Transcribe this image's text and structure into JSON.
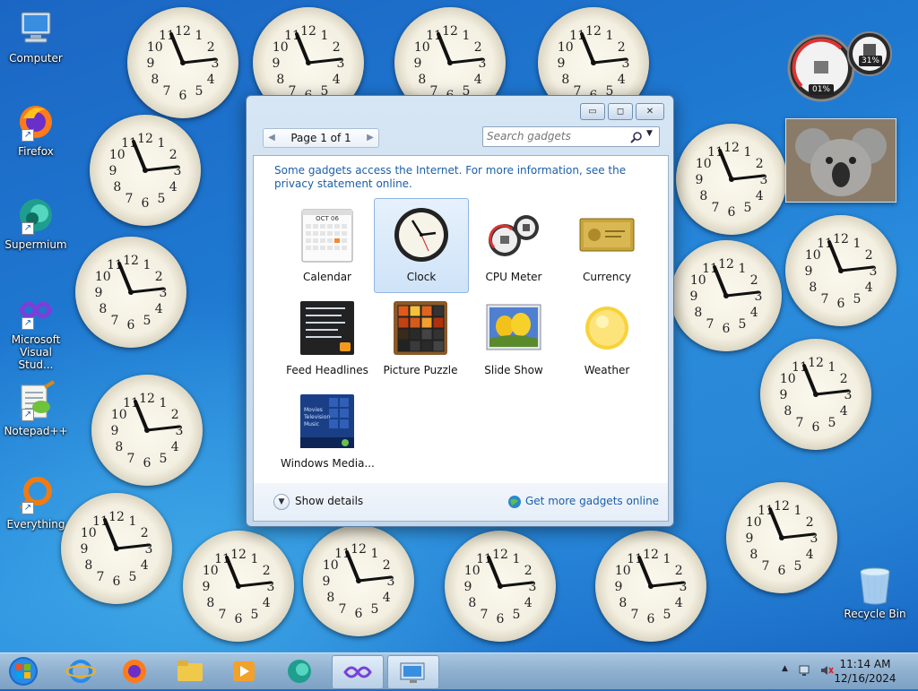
{
  "desktop": {
    "icons": [
      {
        "label": "Computer",
        "icon": "computer-icon"
      },
      {
        "label": "Firefox",
        "icon": "firefox-icon"
      },
      {
        "label": "Supermium",
        "icon": "supermium-icon"
      },
      {
        "label": "Microsoft Visual Stud...",
        "icon": "visual-studio-icon"
      },
      {
        "label": "Notepad++",
        "icon": "notepadpp-icon"
      },
      {
        "label": "Everything",
        "icon": "everything-icon"
      }
    ],
    "recycle_bin": "Recycle Bin"
  },
  "side_gadgets": {
    "cpu_meter": {
      "cpu_percent": "01%",
      "memory_percent": "31%"
    },
    "slideshow_image": "koala-photo"
  },
  "gadget_window": {
    "pager": {
      "text": "Page 1 of 1"
    },
    "search": {
      "placeholder": "Search gadgets"
    },
    "notice": "Some gadgets access the Internet.  For more information, see the privacy statement online.",
    "gadgets": [
      {
        "label": "Calendar",
        "icon": "calendar-icon",
        "month": "OCT 06"
      },
      {
        "label": "Clock",
        "icon": "clock-icon",
        "selected": true
      },
      {
        "label": "CPU Meter",
        "icon": "cpu-meter-icon"
      },
      {
        "label": "Currency",
        "icon": "currency-icon"
      },
      {
        "label": "Feed Headlines",
        "icon": "feed-headlines-icon"
      },
      {
        "label": "Picture Puzzle",
        "icon": "picture-puzzle-icon"
      },
      {
        "label": "Slide Show",
        "icon": "slide-show-icon"
      },
      {
        "label": "Weather",
        "icon": "weather-icon"
      },
      {
        "label": "Windows Media...",
        "icon": "windows-media-icon",
        "menu": [
          "Movies",
          "Television",
          "Music"
        ]
      }
    ],
    "show_details": "Show details",
    "get_more": "Get more gadgets online"
  },
  "taskbar": {
    "apps": [
      "internet-explorer-icon",
      "firefox-icon",
      "file-explorer-icon",
      "media-player-icon",
      "supermium-icon",
      "visual-studio-icon",
      "gadgets-icon"
    ],
    "time": "11:14 AM",
    "date": "12/16/2024"
  },
  "colors": {
    "link": "#1b5fa8",
    "desktop": "#1f7bd2"
  }
}
